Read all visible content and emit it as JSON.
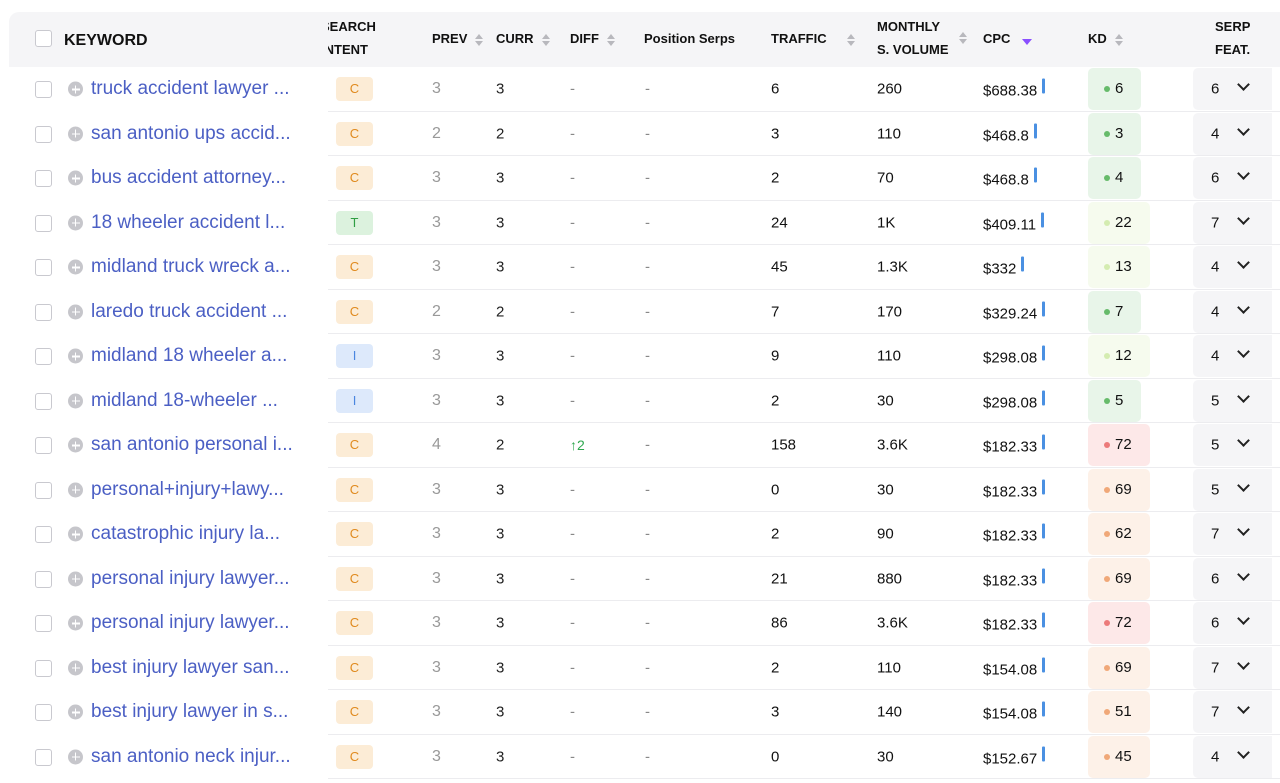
{
  "header": {
    "keyword": "KEYWORD",
    "intent_line1": "SEARCH",
    "intent_line2": "INTENT",
    "prev": "PREV",
    "curr": "CURR",
    "diff": "DIFF",
    "position_serps": "Position Serps",
    "traffic": "TRAFFIC",
    "volume_line1": "MONTHLY",
    "volume_line2": "S. VOLUME",
    "cpc": "CPC",
    "kd": "KD",
    "serp_line1": "SERP",
    "serp_line2": "FEAT."
  },
  "colors": {
    "keyword_link": "#4b5fc4",
    "intent_C_bg": "#fcecd6",
    "intent_C_fg": "#e08a1e",
    "intent_T_bg": "#dcf2de",
    "intent_T_fg": "#2f9e44",
    "intent_I_bg": "#dde9fb",
    "intent_I_fg": "#4a86e0",
    "cpc_bar": "#4a90e2",
    "sort_active": "#8a4fff"
  },
  "rows": [
    {
      "keyword": "truck accident lawyer ...",
      "intent": "C",
      "prev": "3",
      "curr": "3",
      "diff": "-",
      "pos": "-",
      "traffic": "6",
      "volume": "260",
      "cpc": "$688.38",
      "kd": "6",
      "kd_level": "easy",
      "serp": "6"
    },
    {
      "keyword": "san antonio ups accid...",
      "intent": "C",
      "prev": "2",
      "curr": "2",
      "diff": "-",
      "pos": "-",
      "traffic": "3",
      "volume": "110",
      "cpc": "$468.8",
      "kd": "3",
      "kd_level": "easy",
      "serp": "4"
    },
    {
      "keyword": "bus accident attorney...",
      "intent": "C",
      "prev": "3",
      "curr": "3",
      "diff": "-",
      "pos": "-",
      "traffic": "2",
      "volume": "70",
      "cpc": "$468.8",
      "kd": "4",
      "kd_level": "easy",
      "serp": "6"
    },
    {
      "keyword": "18 wheeler accident l...",
      "intent": "T",
      "prev": "3",
      "curr": "3",
      "diff": "-",
      "pos": "-",
      "traffic": "24",
      "volume": "1K",
      "cpc": "$409.11",
      "kd": "22",
      "kd_level": "light",
      "serp": "7"
    },
    {
      "keyword": "midland truck wreck a...",
      "intent": "C",
      "prev": "3",
      "curr": "3",
      "diff": "-",
      "pos": "-",
      "traffic": "45",
      "volume": "1.3K",
      "cpc": "$332",
      "kd": "13",
      "kd_level": "light",
      "serp": "4"
    },
    {
      "keyword": "laredo truck accident ...",
      "intent": "C",
      "prev": "2",
      "curr": "2",
      "diff": "-",
      "pos": "-",
      "traffic": "7",
      "volume": "170",
      "cpc": "$329.24",
      "kd": "7",
      "kd_level": "easy",
      "serp": "4"
    },
    {
      "keyword": "midland 18 wheeler a...",
      "intent": "I",
      "prev": "3",
      "curr": "3",
      "diff": "-",
      "pos": "-",
      "traffic": "9",
      "volume": "110",
      "cpc": "$298.08",
      "kd": "12",
      "kd_level": "light",
      "serp": "4"
    },
    {
      "keyword": "midland 18-wheeler ...",
      "intent": "I",
      "prev": "3",
      "curr": "3",
      "diff": "-",
      "pos": "-",
      "traffic": "2",
      "volume": "30",
      "cpc": "$298.08",
      "kd": "5",
      "kd_level": "easy",
      "serp": "5"
    },
    {
      "keyword": "san antonio personal i...",
      "intent": "C",
      "prev": "4",
      "curr": "2",
      "diff": "↑2",
      "diff_up": true,
      "pos": "-",
      "traffic": "158",
      "volume": "3.6K",
      "cpc": "$182.33",
      "kd": "72",
      "kd_level": "hard",
      "serp": "5"
    },
    {
      "keyword": "personal+injury+lawy...",
      "intent": "C",
      "prev": "3",
      "curr": "3",
      "diff": "-",
      "pos": "-",
      "traffic": "0",
      "volume": "30",
      "cpc": "$182.33",
      "kd": "69",
      "kd_level": "medium",
      "serp": "5"
    },
    {
      "keyword": "catastrophic injury la...",
      "intent": "C",
      "prev": "3",
      "curr": "3",
      "diff": "-",
      "pos": "-",
      "traffic": "2",
      "volume": "90",
      "cpc": "$182.33",
      "kd": "62",
      "kd_level": "medium",
      "serp": "7"
    },
    {
      "keyword": "personal injury lawyer...",
      "intent": "C",
      "prev": "3",
      "curr": "3",
      "diff": "-",
      "pos": "-",
      "traffic": "21",
      "volume": "880",
      "cpc": "$182.33",
      "kd": "69",
      "kd_level": "medium",
      "serp": "6"
    },
    {
      "keyword": "personal injury lawyer...",
      "intent": "C",
      "prev": "3",
      "curr": "3",
      "diff": "-",
      "pos": "-",
      "traffic": "86",
      "volume": "3.6K",
      "cpc": "$182.33",
      "kd": "72",
      "kd_level": "hard",
      "serp": "6"
    },
    {
      "keyword": "best injury lawyer san...",
      "intent": "C",
      "prev": "3",
      "curr": "3",
      "diff": "-",
      "pos": "-",
      "traffic": "2",
      "volume": "110",
      "cpc": "$154.08",
      "kd": "69",
      "kd_level": "medium",
      "serp": "7"
    },
    {
      "keyword": "best injury lawyer in s...",
      "intent": "C",
      "prev": "3",
      "curr": "3",
      "diff": "-",
      "pos": "-",
      "traffic": "3",
      "volume": "140",
      "cpc": "$154.08",
      "kd": "51",
      "kd_level": "medium",
      "serp": "7"
    },
    {
      "keyword": "san antonio neck injur...",
      "intent": "C",
      "prev": "3",
      "curr": "3",
      "diff": "-",
      "pos": "-",
      "traffic": "0",
      "volume": "30",
      "cpc": "$152.67",
      "kd": "45",
      "kd_level": "medium",
      "serp": "4"
    }
  ]
}
